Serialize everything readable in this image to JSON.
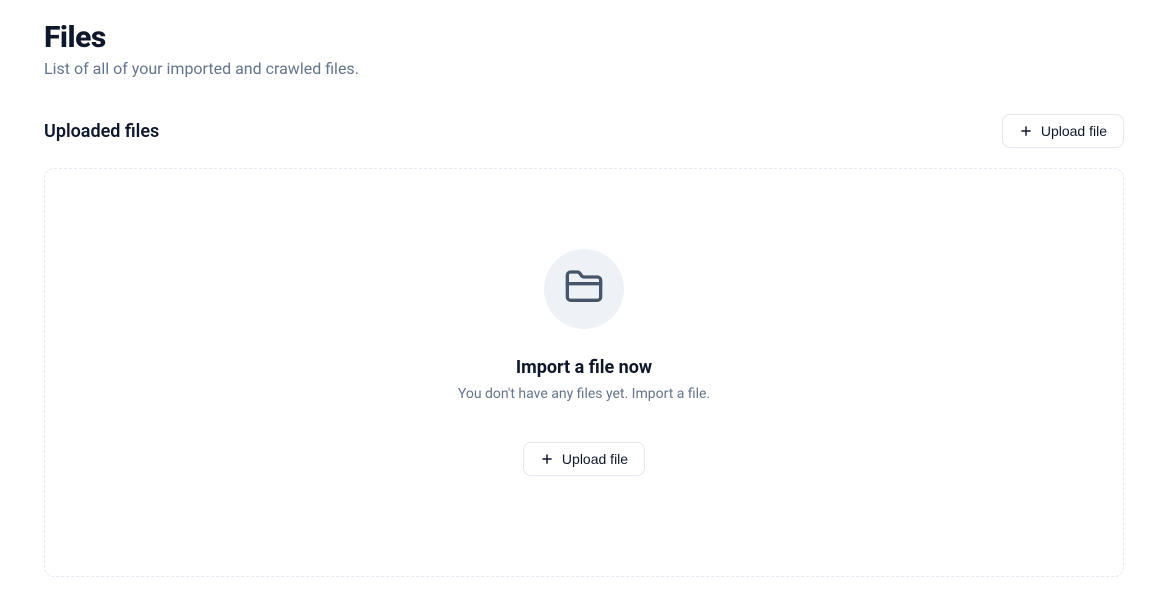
{
  "header": {
    "title": "Files",
    "subtitle": "List of all of your imported and crawled files."
  },
  "section": {
    "title": "Uploaded files",
    "upload_button_label": "Upload file"
  },
  "empty_state": {
    "title": "Import a file now",
    "subtitle": "You don't have any files yet. Import a file.",
    "upload_button_label": "Upload file"
  }
}
